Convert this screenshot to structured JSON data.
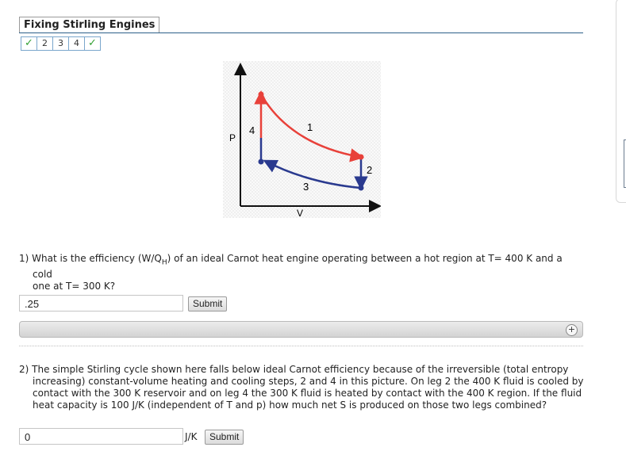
{
  "header": {
    "title": "Fixing Stirling Engines"
  },
  "steps": [
    {
      "label": "✓",
      "status": "complete"
    },
    {
      "label": "2",
      "status": "pending"
    },
    {
      "label": "3",
      "status": "pending"
    },
    {
      "label": "4",
      "status": "pending"
    },
    {
      "label": "✓",
      "status": "complete"
    }
  ],
  "diagram": {
    "axis_p": "P",
    "axis_v": "V",
    "leg_labels": {
      "one": "1",
      "two": "2",
      "three": "3",
      "four": "4"
    },
    "colors": {
      "hot": "#e8413a",
      "cold": "#2a3a8f",
      "axis": "#111111"
    }
  },
  "question1": {
    "number": "1)",
    "text_line1": "What is the efficiency (W/Q",
    "subscript": "H",
    "text_line1_rest": ") of an ideal Carnot heat engine operating between a hot region at T= 400 K and a cold",
    "text_line2": "one at T= 300 K?",
    "answer_value": ".25",
    "submit_label": "Submit"
  },
  "question2": {
    "text": "2) The simple Stirling cycle shown here falls below ideal Carnot efficiency because of the irreversible (total entropy increasing) constant-volume heating and cooling steps, 2 and 4 in this picture. On leg 2 the 400 K fluid is cooled by contact with the 300 K reservoir and on leg 4 the 300 K fluid is heated by contact with the 400 K region. If the fluid heat capacity is 100 J/K (independent of T and p) how much net S is produced on those two legs combined?",
    "answer_value": "0",
    "unit": "J/K",
    "submit_label": "Submit"
  },
  "feedback": {
    "expand_icon": "plus-circle-icon"
  }
}
